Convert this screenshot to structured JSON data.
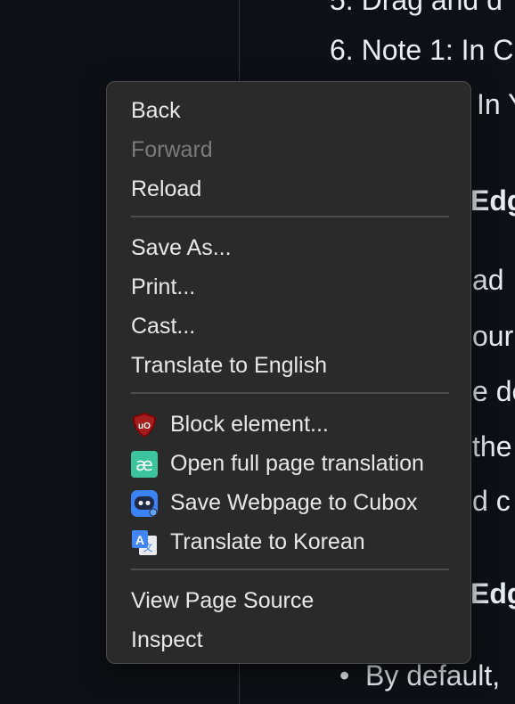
{
  "page": {
    "line1": "5. Drag and d",
    "line2": "6. Note 1: In C",
    "line3": "In Y",
    "heading1": "Edg",
    "para": [
      "ad",
      "our",
      "e de",
      "the",
      "d c"
    ],
    "heading2": "Edg",
    "bullet": "By default,"
  },
  "menu": {
    "back": "Back",
    "forward": "Forward",
    "reload": "Reload",
    "save_as": "Save As...",
    "print": "Print...",
    "cast": "Cast...",
    "translate_english": "Translate to English",
    "block_element": "Block element...",
    "open_translation": "Open full page translation",
    "save_cubox": "Save Webpage to Cubox",
    "translate_korean": "Translate to Korean",
    "view_source": "View Page Source",
    "inspect": "Inspect"
  },
  "icons": {
    "ublock": "ublock-shield-icon",
    "translation": "ae-translation-icon",
    "cubox": "cubox-icon",
    "translate": "google-translate-icon"
  },
  "colors": {
    "menu_bg": "#2b2a2b",
    "text": "#e8e8e8",
    "disabled": "#7b7a7c",
    "ublock_red": "#800000",
    "translation_teal": "#3dc49f",
    "cubox_blue": "#3b82f6",
    "translate_blue": "#4285f4"
  }
}
